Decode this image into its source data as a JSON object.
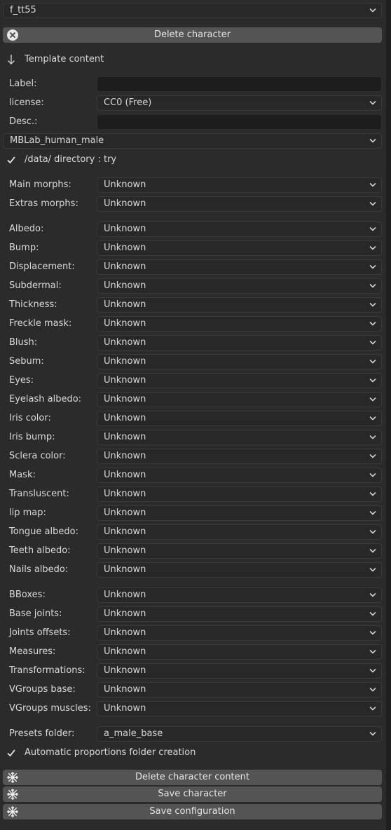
{
  "top": {
    "character_select": "f_tt55",
    "delete_button": "Delete character",
    "template_header": "Template content"
  },
  "meta": {
    "label_label": "Label:",
    "label_value": "",
    "license_label": "license:",
    "license_value": "CC0 (Free)",
    "desc_label": "Desc.:",
    "desc_value": "",
    "base_model": "MBLab_human_male",
    "data_dir_text": "/data/ directory : try"
  },
  "morphs": [
    {
      "label": "Main morphs:",
      "value": "Unknown"
    },
    {
      "label": "Extras morphs:",
      "value": "Unknown"
    }
  ],
  "textures": [
    {
      "label": "Albedo:",
      "value": "Unknown"
    },
    {
      "label": "Bump:",
      "value": "Unknown"
    },
    {
      "label": "Displacement:",
      "value": "Unknown"
    },
    {
      "label": "Subdermal:",
      "value": "Unknown"
    },
    {
      "label": "Thickness:",
      "value": "Unknown"
    },
    {
      "label": "Freckle mask:",
      "value": "Unknown"
    },
    {
      "label": "Blush:",
      "value": "Unknown"
    },
    {
      "label": "Sebum:",
      "value": "Unknown"
    },
    {
      "label": "Eyes:",
      "value": "Unknown"
    },
    {
      "label": "Eyelash albedo:",
      "value": "Unknown"
    },
    {
      "label": "Iris color:",
      "value": "Unknown"
    },
    {
      "label": "Iris bump:",
      "value": "Unknown"
    },
    {
      "label": "Sclera color:",
      "value": "Unknown"
    },
    {
      "label": "Mask:",
      "value": "Unknown"
    },
    {
      "label": "Transluscent:",
      "value": "Unknown"
    },
    {
      "label": "lip map:",
      "value": "Unknown"
    },
    {
      "label": "Tongue albedo:",
      "value": "Unknown"
    },
    {
      "label": "Teeth albedo:",
      "value": "Unknown"
    },
    {
      "label": "Nails albedo:",
      "value": "Unknown"
    }
  ],
  "structure": [
    {
      "label": "BBoxes:",
      "value": "Unknown"
    },
    {
      "label": "Base joints:",
      "value": "Unknown"
    },
    {
      "label": "Joints offsets:",
      "value": "Unknown"
    },
    {
      "label": "Measures:",
      "value": "Unknown"
    },
    {
      "label": "Transformations:",
      "value": "Unknown"
    },
    {
      "label": "VGroups base:",
      "value": "Unknown"
    },
    {
      "label": "VGroups muscles:",
      "value": "Unknown"
    }
  ],
  "presets": {
    "label": "Presets folder:",
    "value": "a_male_base",
    "auto_text": "Automatic proportions folder creation"
  },
  "actions": {
    "delete_content": "Delete character content",
    "save_character": "Save character",
    "save_config": "Save configuration"
  },
  "icons": {
    "delete": "close-circle-icon",
    "template": "arrow-down-icon",
    "check": "checkmark-icon",
    "action": "snowflake-icon",
    "dropdown": "chevron-down-icon"
  }
}
